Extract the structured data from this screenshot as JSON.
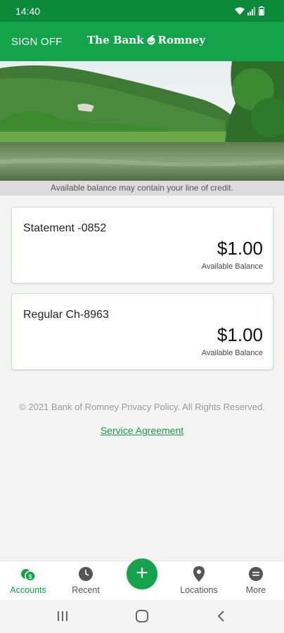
{
  "status_bar": {
    "time": "14:40"
  },
  "header": {
    "sign_off_label": "SIGN OFF",
    "brand_left": "The Bank",
    "brand_right": "Romney"
  },
  "notice": "Available balance may contain your line of credit.",
  "accounts": [
    {
      "name": "Statement -0852",
      "amount": "$1.00",
      "label": "Available Balance"
    },
    {
      "name": "Regular Ch-8963",
      "amount": "$1.00",
      "label": "Available Balance"
    }
  ],
  "footer": {
    "copyright": "© 2021 Bank of Romney Privacy Policy. All Rights Reserved.",
    "service_agreement": "Service Agreement"
  },
  "tabs": [
    {
      "label": "Accounts",
      "icon": "accounts-icon",
      "active": true
    },
    {
      "label": "Recent",
      "icon": "clock-icon",
      "active": false
    },
    {
      "label": "Locations",
      "icon": "location-pin-icon",
      "active": false
    },
    {
      "label": "More",
      "icon": "more-icon",
      "active": false
    }
  ],
  "fab_symbol": "+",
  "colors": {
    "primary": "#14a34a",
    "status_bar": "#0b8a3c",
    "link": "#1a9a45"
  }
}
